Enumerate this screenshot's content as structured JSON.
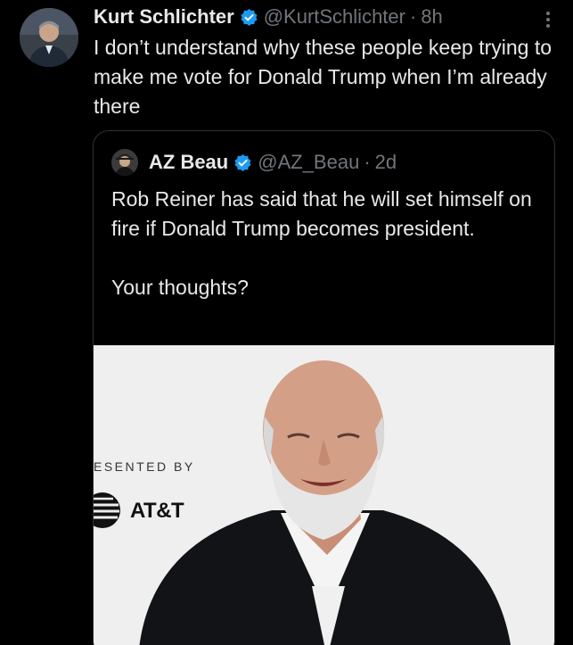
{
  "tweet": {
    "author_name": "Kurt Schlichter",
    "author_handle": "@KurtSchlichter",
    "separator": "·",
    "time": "8h",
    "text": "I don’t understand why these people keep trying to make me vote for Donald Trump when I’m already there"
  },
  "quote": {
    "author_name": "AZ Beau",
    "author_handle": "@AZ_Beau",
    "separator": "·",
    "time": "2d",
    "paragraph_1": "Rob Reiner has said that he will set himself on fire if Donald Trump becomes president.",
    "paragraph_2": "Your thoughts?",
    "media": {
      "backdrop_text": "ESENTED BY",
      "sponsor_text": "AT&T"
    }
  },
  "icons": {
    "verified": "verified-badge-icon",
    "more": "more-options-icon"
  },
  "colors": {
    "background": "#000000",
    "text_primary": "#e7e9ea",
    "text_secondary": "#71767b",
    "verified_blue": "#1d9bf0",
    "border": "#2f3336"
  }
}
